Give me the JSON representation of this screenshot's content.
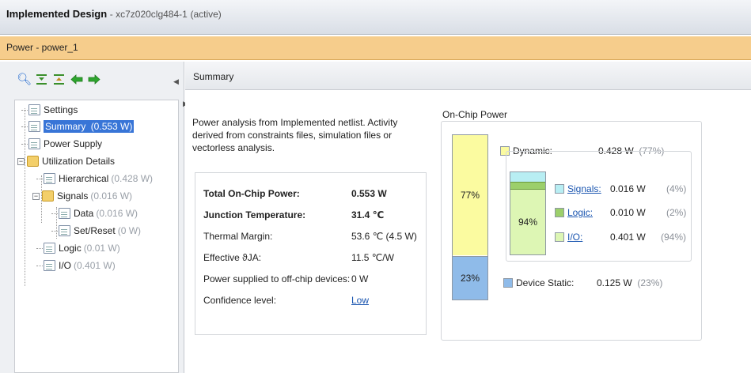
{
  "window": {
    "title": "Implemented Design",
    "subtitle": "- xc7z020clg484-1",
    "state": "(active)"
  },
  "tab": {
    "label": "Power - power_1",
    "accent": "#f6cd8c"
  },
  "toolbar": {
    "icons": [
      "search-icon",
      "collapse-all-icon",
      "expand-all-icon",
      "back-arrow-icon",
      "forward-arrow-icon"
    ]
  },
  "tree": {
    "settings": "Settings",
    "summary": "Summary",
    "summary_val": "(0.553 W)",
    "power_supply": "Power Supply",
    "utilization": "Utilization Details",
    "hierarchical": "Hierarchical",
    "hierarchical_val": "(0.428 W)",
    "signals": "Signals",
    "signals_val": "(0.016 W)",
    "data": "Data",
    "data_val": "(0.016 W)",
    "setreset": "Set/Reset",
    "setreset_val": "(0 W)",
    "logic": "Logic",
    "logic_val": "(0.01 W)",
    "io": "I/O",
    "io_val": "(0.401 W)"
  },
  "panel": {
    "header": "Summary",
    "description": "Power analysis from Implemented netlist. Activity derived from constraints files, simulation files or vectorless analysis."
  },
  "summary": {
    "total_label": "Total On-Chip Power:",
    "total_value": "0.553 W",
    "junction_label": "Junction Temperature:",
    "junction_value": "31.4 ℃",
    "margin_label": "Thermal Margin:",
    "margin_value": "53.6 ℃ (4.5 W)",
    "theta_label": "Effective ϑJA:",
    "theta_value": "11.5 ℃/W",
    "offchip_label": "Power supplied to off-chip devices:",
    "offchip_value": "0 W",
    "confidence_label": "Confidence level:",
    "confidence_value": "Low"
  },
  "onchip": {
    "title": "On-Chip Power",
    "dynamic_label": "Dynamic:",
    "dynamic_value": "0.428 W",
    "dynamic_pct": "(77%)",
    "dynamic_bar_pct": "77%",
    "static_label": "Device Static:",
    "static_value": "0.125 W",
    "static_pct": "(23%)",
    "static_bar_pct": "23%",
    "signals_label": "Signals:",
    "signals_value": "0.016 W",
    "signals_pct": "(4%)",
    "logic_label": "Logic:",
    "logic_value": "0.010 W",
    "logic_pct": "(2%)",
    "io_label": "I/O:",
    "io_value": "0.401 W",
    "io_pct": "(94%)",
    "io_bar_pct": "94%",
    "colors": {
      "dynamic": "#fbfba0",
      "static": "#8fbbe9",
      "signals": "#b8eef3",
      "logic": "#9ccf6b",
      "io": "#ddf6b4"
    }
  }
}
